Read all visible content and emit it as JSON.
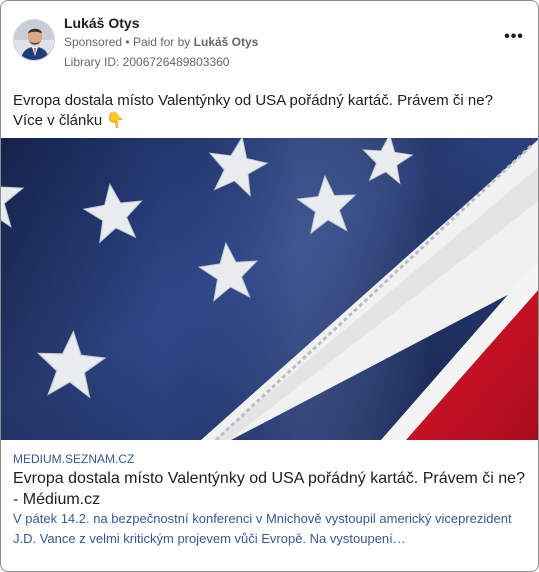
{
  "ad": {
    "page_name": "Lukáš Otys",
    "sponsored_label": "Sponsored",
    "separator": "•",
    "paid_for_prefix": "Paid for by",
    "paid_for_name": "Lukáš Otys",
    "library_id": "Library ID: 2006726489803360",
    "more_icon": "more-horizontal-icon",
    "more_glyph": "•••",
    "body_text": "Evropa dostala místo Valentýnky od USA pořádný kartáč. Právem či ne? Více v článku",
    "emoji": "👇"
  },
  "link_preview": {
    "domain": "MEDIUM.SEZNAM.CZ",
    "headline": "Evropa dostala místo Valentýnky od USA pořádný kartáč. Právem či ne? - Médium.cz",
    "description": "V pátek 14.2. na bezpečnostní konferenci v Mnichově vystoupil americký viceprezident J.D. Vance z velmi kritickým projevem vůči Evropě. Na vystoupení…"
  },
  "colors": {
    "link_blue": "#385898",
    "secondary_text": "#65676b",
    "flag_blue": "#2a3f78",
    "flag_red": "#c8102e"
  }
}
